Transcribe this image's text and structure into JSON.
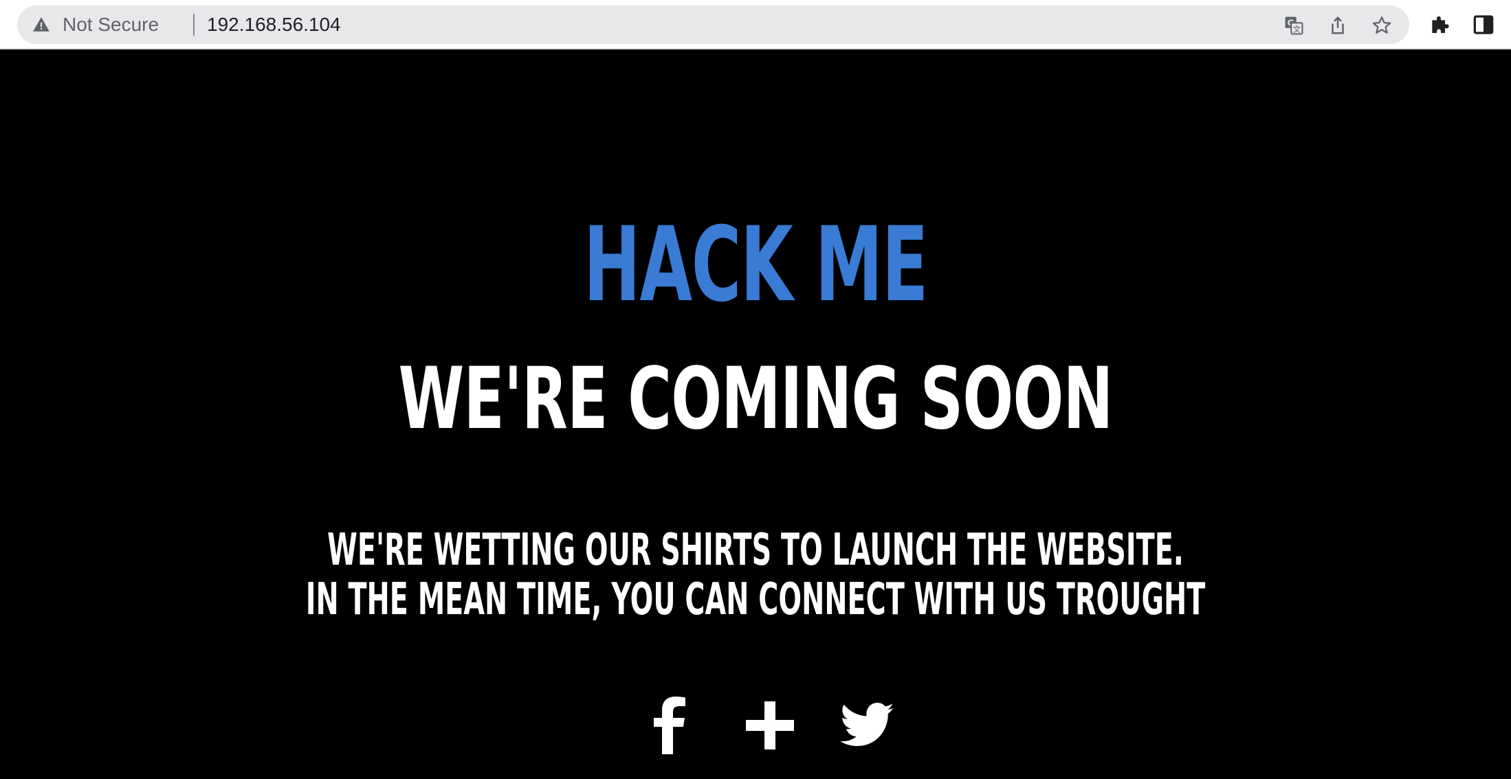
{
  "browser": {
    "security_label": "Not Secure",
    "url": "192.168.56.104",
    "icons": [
      "warning-icon",
      "translate-icon",
      "share-icon",
      "bookmark-star-icon",
      "extensions-icon",
      "side-panel-icon"
    ]
  },
  "page": {
    "brand": "HACK ME",
    "headline": "WE'RE COMING SOON",
    "message_line1": "WE'RE WETTING OUR SHIRTS TO LAUNCH THE WEBSITE.",
    "message_line2": "IN THE MEAN TIME, YOU CAN CONNECT WITH US TROUGHT",
    "social": [
      "facebook-icon",
      "google-plus-icon",
      "twitter-icon"
    ]
  },
  "colors": {
    "background": "#000000",
    "brand": "#3a7bd5",
    "text": "#ffffff"
  }
}
